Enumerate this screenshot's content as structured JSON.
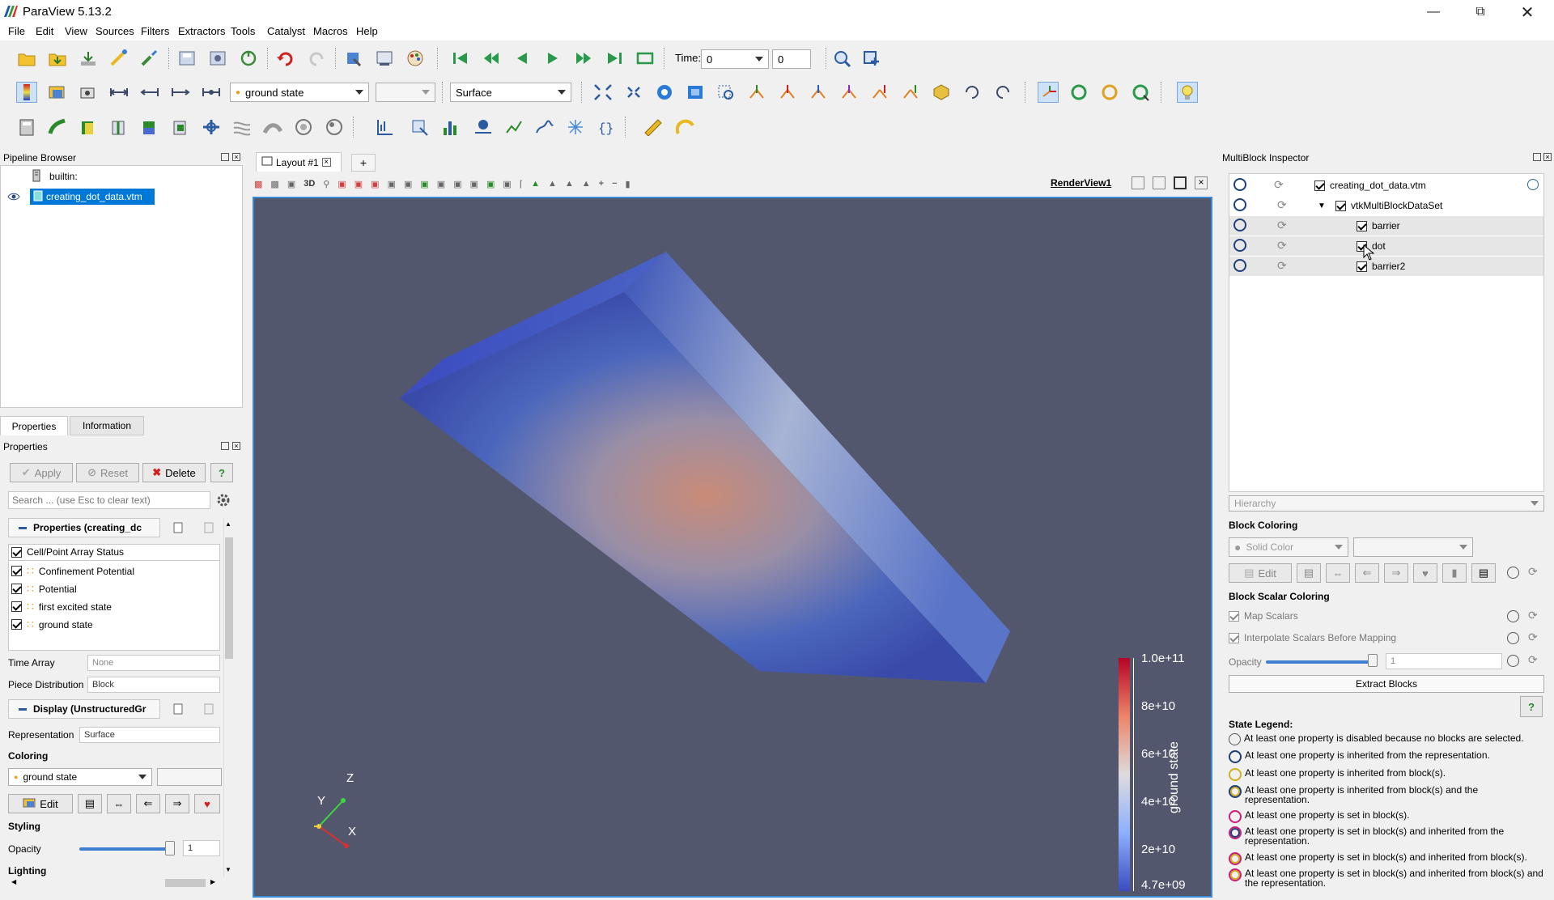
{
  "window": {
    "title": "ParaView 5.13.2"
  },
  "menu": [
    "File",
    "Edit",
    "View",
    "Sources",
    "Filters",
    "Extractors",
    "Tools",
    "Catalyst",
    "Macros",
    "Help"
  ],
  "toolbar": {
    "time_label": "Time:",
    "time_value": "0",
    "timestep_value": "0",
    "color_by": "ground state",
    "component": "",
    "representation": "Surface"
  },
  "pipeline": {
    "title": "Pipeline Browser",
    "items": [
      {
        "label": "builtin:"
      },
      {
        "label": "creating_dot_data.vtm"
      }
    ]
  },
  "tabs": {
    "properties": "Properties",
    "information": "Information"
  },
  "properties": {
    "title": "Properties",
    "apply": "Apply",
    "reset": "Reset",
    "delete": "Delete",
    "help": "?",
    "search_placeholder": "Search ... (use Esc to clear text)",
    "section_properties": "Properties (creating_dc",
    "array_status_header": "Cell/Point Array Status",
    "arrays": [
      {
        "name": "Confinement Potential",
        "checked": true
      },
      {
        "name": "Potential",
        "checked": true
      },
      {
        "name": "first excited state",
        "checked": true
      },
      {
        "name": "ground state",
        "checked": true
      }
    ],
    "time_array_label": "Time Array",
    "time_array_value": "None",
    "piece_distribution_label": "Piece Distribution",
    "piece_distribution_value": "Block",
    "section_display": "Display (UnstructuredGr",
    "representation_label": "Representation",
    "representation_value": "Surface",
    "coloring_header": "Coloring",
    "coloring_value": "ground state",
    "edit_label": "Edit",
    "styling_header": "Styling",
    "opacity_label": "Opacity",
    "opacity_value": "1",
    "opacity_fraction": 1.0,
    "lighting_header": "Lighting"
  },
  "layout": {
    "tab_label": "Layout #1",
    "add_tab": "+",
    "view_name": "RenderView1",
    "mode_3d": "3D"
  },
  "render": {
    "background": "#52576d",
    "axes": {
      "z": "Z",
      "y": "Y",
      "x": "X"
    },
    "colorbar": {
      "title": "ground state",
      "ticks": [
        "1.0e+11",
        "8e+10",
        "6e+10",
        "4e+10",
        "2e+10",
        "4.7e+09"
      ],
      "colors": [
        "#b40426",
        "#ee8468",
        "#dddcdc",
        "#8db0fe",
        "#3b4cc0"
      ]
    }
  },
  "multiblock": {
    "title": "MultiBlock Inspector",
    "tree": [
      {
        "label": "creating_dot_data.vtm",
        "level": 0,
        "checked": true
      },
      {
        "label": "vtkMultiBlockDataSet",
        "level": 1,
        "checked": true
      },
      {
        "label": "barrier",
        "level": 2,
        "checked": true
      },
      {
        "label": "dot",
        "level": 2,
        "checked": true
      },
      {
        "label": "barrier2",
        "level": 2,
        "checked": true
      }
    ],
    "view_mode": "Hierarchy",
    "block_coloring_header": "Block Coloring",
    "solid_color": "Solid Color",
    "edit_label": "Edit",
    "block_scalar_header": "Block Scalar Coloring",
    "map_scalars": "Map Scalars",
    "interpolate": "Interpolate Scalars Before Mapping",
    "opacity_label": "Opacity",
    "opacity_value": "1",
    "extract_blocks": "Extract Blocks",
    "help": "?",
    "legend_title": "State Legend:",
    "legend": [
      "At least one property is disabled because no blocks are selected.",
      "At least one property is inherited from the representation.",
      "At least one property is inherited from block(s).",
      "At least one property is inherited from block(s) and the representation.",
      "At least one property is set in block(s).",
      "At least one property is set in block(s) and inherited from the representation.",
      "At least one property is set in block(s) and inherited from block(s).",
      "At least one property is set in block(s) and inherited from block(s) and the representation."
    ]
  },
  "colors": {
    "accent": "#0078d7",
    "selection": "#0078d7"
  }
}
